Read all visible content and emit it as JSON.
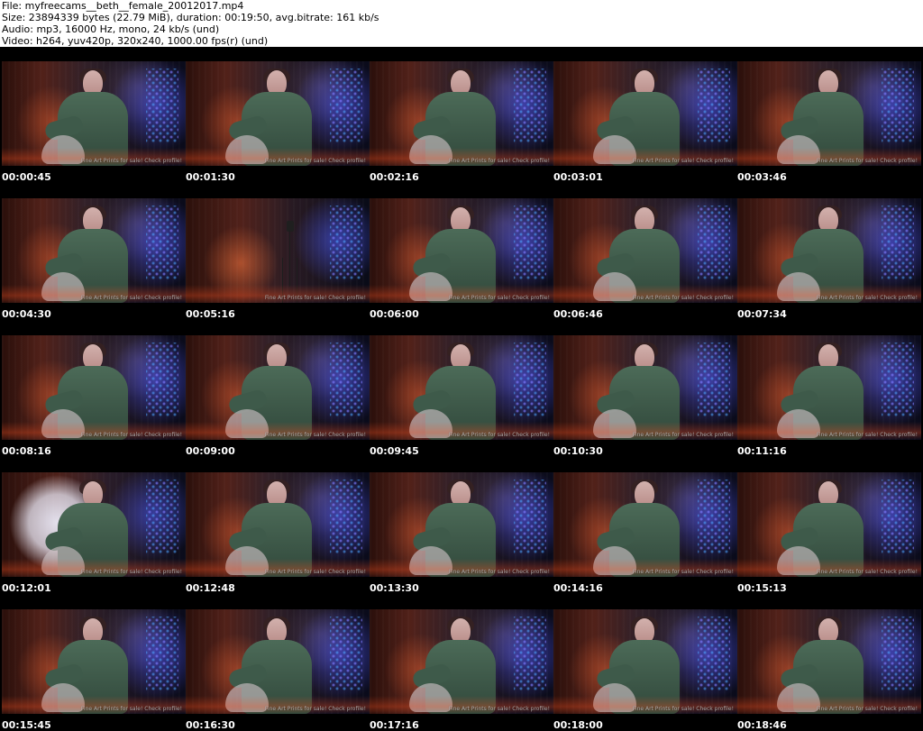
{
  "header": {
    "file_line": "File: myfreecams__beth__female_20012017.mp4",
    "size_line": "Size: 23894339 bytes (22.79 MiB), duration: 00:19:50, avg.bitrate: 161 kb/s",
    "audio_line": "Audio: mp3, 16000 Hz, mono, 24 kb/s (und)",
    "video_line": "Video: h264, yuv420p, 320x240, 1000.00 fps(r) (und)"
  },
  "tiles": [
    {
      "time": "00:00:45",
      "watermark": "Fine Art Prints for sale! Check profile!"
    },
    {
      "time": "00:01:30",
      "watermark": "Fine Art Prints for sale! Check profile!"
    },
    {
      "time": "00:02:16",
      "watermark": "Fine Art Prints for sale! Check profile!"
    },
    {
      "time": "00:03:01",
      "watermark": "Fine Art Prints for sale! Check profile!"
    },
    {
      "time": "00:03:46",
      "watermark": "Fine Art Prints for sale! Check profile!"
    },
    {
      "time": "00:04:30",
      "watermark": "Fine Art Prints for sale! Check profile!"
    },
    {
      "time": "00:05:16",
      "watermark": "Fine Art Prints for sale! Check profile!"
    },
    {
      "time": "00:06:00",
      "watermark": "Fine Art Prints for sale! Check profile!"
    },
    {
      "time": "00:06:46",
      "watermark": "Fine Art Prints for sale! Check profile!"
    },
    {
      "time": "00:07:34",
      "watermark": "Fine Art Prints for sale! Check profile!"
    },
    {
      "time": "00:08:16",
      "watermark": "Fine Art Prints for sale! Check profile!"
    },
    {
      "time": "00:09:00",
      "watermark": "Fine Art Prints for sale! Check profile!"
    },
    {
      "time": "00:09:45",
      "watermark": "Fine Art Prints for sale! Check profile!"
    },
    {
      "time": "00:10:30",
      "watermark": "Fine Art Prints for sale! Check profile!"
    },
    {
      "time": "00:11:16",
      "watermark": "Fine Art Prints for sale! Check profile!"
    },
    {
      "time": "00:12:01",
      "watermark": "Fine Art Prints for sale! Check profile!"
    },
    {
      "time": "00:12:48",
      "watermark": "Fine Art Prints for sale! Check profile!"
    },
    {
      "time": "00:13:30",
      "watermark": "Fine Art Prints for sale! Check profile!"
    },
    {
      "time": "00:14:16",
      "watermark": "Fine Art Prints for sale! Check profile!"
    },
    {
      "time": "00:15:13",
      "watermark": "Fine Art Prints for sale! Check profile!"
    },
    {
      "time": "00:15:45",
      "watermark": "Fine Art Prints for sale! Check profile!"
    },
    {
      "time": "00:16:30",
      "watermark": "Fine Art Prints for sale! Check profile!"
    },
    {
      "time": "00:17:16",
      "watermark": "Fine Art Prints for sale! Check profile!"
    },
    {
      "time": "00:18:00",
      "watermark": "Fine Art Prints for sale! Check profile!"
    },
    {
      "time": "00:18:46",
      "watermark": "Fine Art Prints for sale! Check profile!"
    }
  ]
}
